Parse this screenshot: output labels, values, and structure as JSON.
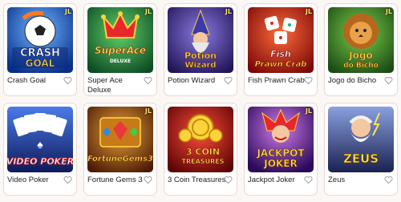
{
  "games": [
    {
      "title": "Crash Goal",
      "art_text": [
        "CRASH",
        "GOAL"
      ],
      "badge": "JL",
      "bg": "#1b5fc9"
    },
    {
      "title": "Super Ace Deluxe",
      "title_lines": [
        "Super Ace",
        "Deluxe"
      ],
      "art_text": [
        "SuperAce",
        "DELUXE"
      ],
      "badge": "JL",
      "bg": "#1d7a3a"
    },
    {
      "title": "Potion Wizard",
      "art_text": [
        "Potion",
        "Wizard"
      ],
      "badge": "JL",
      "bg": "#4a2f96"
    },
    {
      "title": "Fish Prawn Crab",
      "art_text": [
        "Fish",
        "Prawn Crab"
      ],
      "badge": "JL",
      "bg": "#c8241c"
    },
    {
      "title": "Jogo do Bicho",
      "art_text": [
        "Jogo",
        "do Bicho"
      ],
      "badge": "JL",
      "bg": "#2e7a2b"
    },
    {
      "title": "Video Poker",
      "art_text": [
        "VIDEO POKER"
      ],
      "badge": "",
      "bg": "#2a3fa0"
    },
    {
      "title": "Fortune Gems 3",
      "art_text": [
        "FortuneGems3"
      ],
      "badge": "JL",
      "bg": "#8a3a10"
    },
    {
      "title": "3 Coin Treasures",
      "art_text": [
        "3 COIN",
        "TREASURES"
      ],
      "badge": "",
      "bg": "#b01010"
    },
    {
      "title": "Jackpot Joker",
      "art_text": [
        "JACKPOT",
        "JOKER"
      ],
      "badge": "JL",
      "bg": "#6a2aa8"
    },
    {
      "title": "Zeus",
      "art_text": [
        "ZEUS"
      ],
      "badge": "",
      "bg": "#3a4a8a"
    }
  ],
  "icons": {
    "favorite": "heart-outline-icon"
  },
  "colors": {
    "page_bg": "#fbf7f5",
    "card_border": "#ead8d4",
    "heart": "#999999"
  }
}
